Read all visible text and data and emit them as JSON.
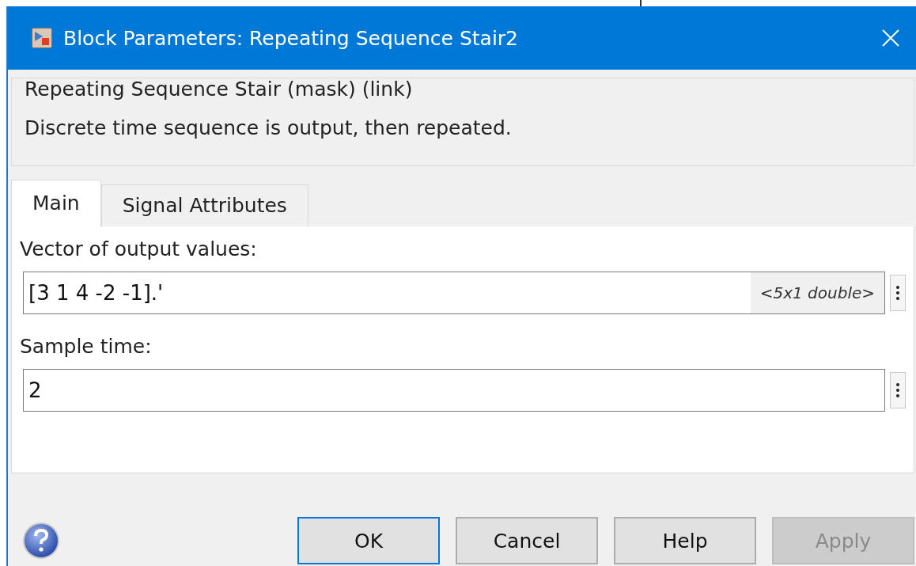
{
  "window": {
    "title": "Block Parameters: Repeating Sequence Stair2"
  },
  "description_group": {
    "title": "Repeating Sequence Stair (mask) (link)",
    "text": "Discrete time sequence is output, then repeated."
  },
  "tabs": [
    {
      "label": "Main",
      "selected": true
    },
    {
      "label": "Signal Attributes",
      "selected": false
    }
  ],
  "fields": [
    {
      "label": "Vector of output values:",
      "value": "[3 1 4 -2 -1].'",
      "type_hint": "<5x1 double>"
    },
    {
      "label": "Sample time:",
      "value": "2"
    }
  ],
  "buttons": [
    {
      "label": "OK",
      "default": true,
      "disabled": false
    },
    {
      "label": "Cancel",
      "default": false,
      "disabled": false
    },
    {
      "label": "Help",
      "default": false,
      "disabled": false
    },
    {
      "label": "Apply",
      "default": false,
      "disabled": true
    }
  ]
}
